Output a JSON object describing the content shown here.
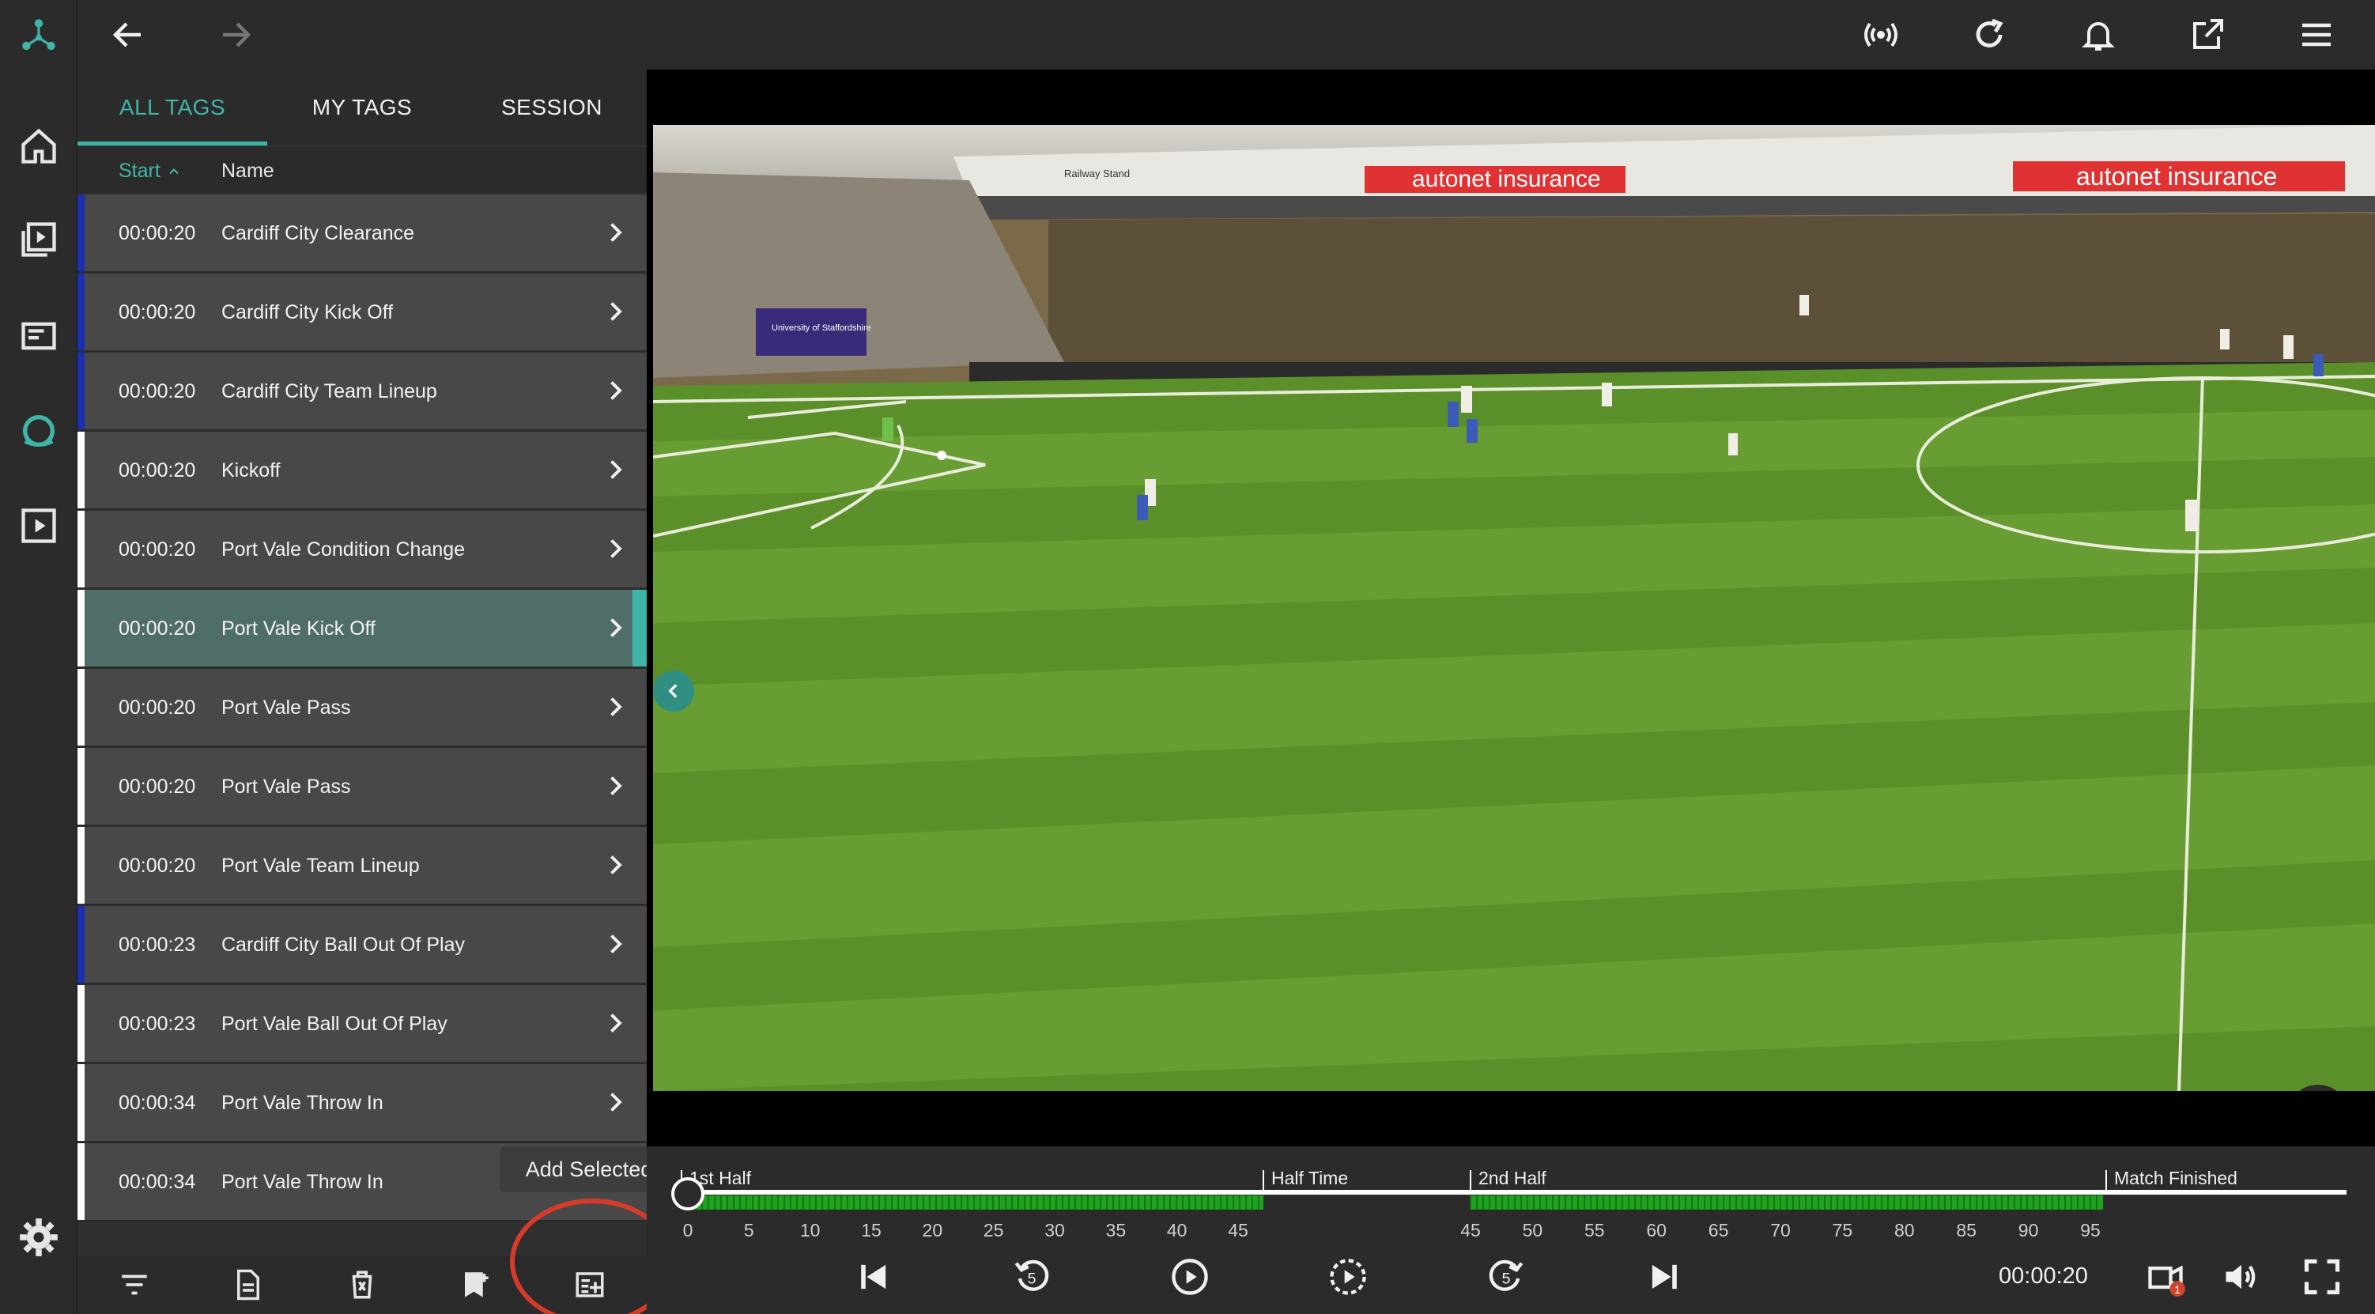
{
  "tabs": [
    "ALL TAGS",
    "MY TAGS",
    "SESSION"
  ],
  "columns": {
    "start": "Start",
    "name": "Name"
  },
  "tags": [
    {
      "time": "00:00:20",
      "name": "Cardiff City Clearance",
      "team": "cardiff"
    },
    {
      "time": "00:00:20",
      "name": "Cardiff City Kick Off",
      "team": "cardiff"
    },
    {
      "time": "00:00:20",
      "name": "Cardiff City Team Lineup",
      "team": "cardiff"
    },
    {
      "time": "00:00:20",
      "name": "Kickoff",
      "team": "none"
    },
    {
      "time": "00:00:20",
      "name": "Port Vale Condition Change",
      "team": "portvale"
    },
    {
      "time": "00:00:20",
      "name": "Port Vale Kick Off",
      "team": "portvale",
      "selected": true
    },
    {
      "time": "00:00:20",
      "name": "Port Vale Pass",
      "team": "portvale"
    },
    {
      "time": "00:00:20",
      "name": "Port Vale Pass",
      "team": "portvale"
    },
    {
      "time": "00:00:20",
      "name": "Port Vale Team Lineup",
      "team": "portvale"
    },
    {
      "time": "00:00:23",
      "name": "Cardiff City Ball Out Of Play",
      "team": "cardiff"
    },
    {
      "time": "00:00:23",
      "name": "Port Vale Ball Out Of Play",
      "team": "portvale"
    },
    {
      "time": "00:00:34",
      "name": "Port Vale Throw In",
      "team": "portvale"
    },
    {
      "time": "00:00:34",
      "name": "Port Vale Throw In",
      "team": "portvale"
    }
  ],
  "team_colors": {
    "cardiff": "#1b2fb5",
    "portvale": "#ffffff",
    "none": "#ffffff"
  },
  "tooltip": "Add Selected",
  "video": {
    "banner_left": "autonet insurance",
    "banner_right": "autonet insurance",
    "stand_label": "Railway Stand",
    "board_text": "University of Staffordshire"
  },
  "timeline": {
    "sections": [
      "1st Half",
      "Half Time",
      "2nd Half",
      "Match Finished"
    ],
    "ticks_first": [
      "0",
      "5",
      "10",
      "15",
      "20",
      "25",
      "30",
      "35",
      "40",
      "45"
    ],
    "ticks_second": [
      "45",
      "50",
      "55",
      "60",
      "65",
      "70",
      "75",
      "80",
      "85",
      "90",
      "95"
    ],
    "accent": "#1fa31f"
  },
  "player": {
    "time": "00:00:20",
    "skip_seconds": "5",
    "camera_badge": "1"
  }
}
